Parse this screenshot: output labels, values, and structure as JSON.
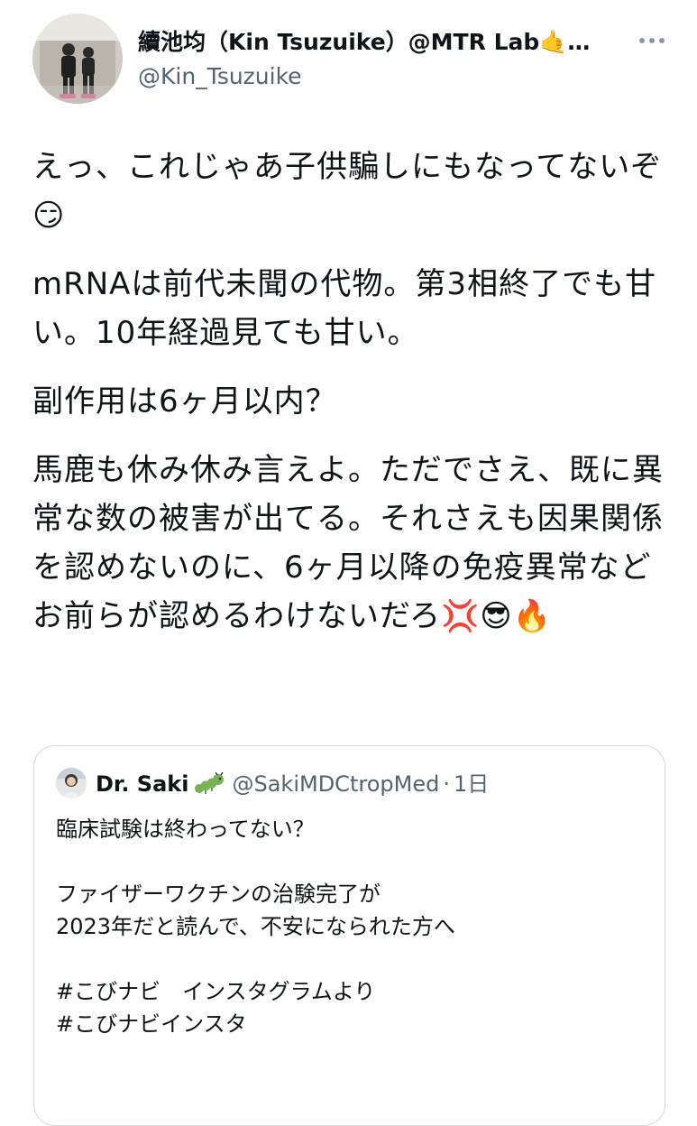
{
  "tweet": {
    "author_name": "續池均（Kin Tsuzuike）@MTR Lab🤙…",
    "author_handle": "@Kin_Tsuzuike",
    "paragraphs": [
      "えっ、これじゃあ子供騙しにもなってないぞ😏",
      "mRNAは前代未聞の代物。第3相終了でも甘い。10年経過見ても甘い。",
      "副作用は6ヶ月以内？",
      "馬鹿も休み休み言えよ。ただでさえ、既に異常な数の被害が出てる。それさえも因果関係を認めないのに、6ヶ月以降の免疫異常などお前らが認めるわけないだろ💢😎🔥"
    ]
  },
  "quote": {
    "author_name": "Dr. Saki",
    "name_emoji": "🐛",
    "author_handle": "@SakiMDCtropMed",
    "separator": "·",
    "time": "1日",
    "lines": [
      "臨床試験は終わってない？",
      "",
      "ファイザーワクチンの治験完了が",
      "2023年だと読んで、不安になられた方へ",
      "",
      "#こびナビ　インスタグラムより",
      "#こびナビインスタ"
    ]
  },
  "icons": {
    "more": "more-horizontal-icon",
    "caterpillar": "caterpillar-emoji-icon"
  },
  "colors": {
    "text": "#0f1419",
    "secondary": "#536471",
    "border": "#cfd9de"
  }
}
